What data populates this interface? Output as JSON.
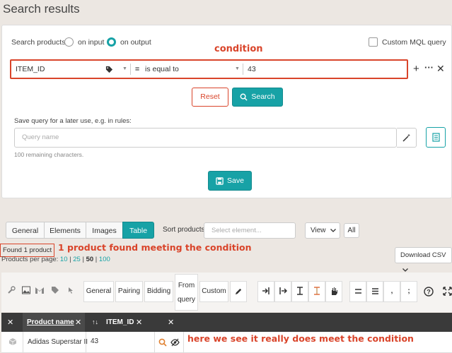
{
  "page": {
    "title": "Search results"
  },
  "search": {
    "label": "Search products:",
    "radio_input": "on input",
    "radio_output": "on output",
    "custom_mql": "Custom MQL query",
    "annotation": "condition",
    "field": "ITEM_ID",
    "operator": "is equal to",
    "value": "43",
    "reset": "Reset",
    "search": "Search"
  },
  "save_query": {
    "label": "Save query for a later use, e.g. in rules:",
    "placeholder": "Query name",
    "remaining": "100 remaining characters.",
    "save": "Save"
  },
  "tabs": [
    "General",
    "Elements",
    "Images",
    "Table"
  ],
  "sort": {
    "label": "Sort products",
    "placeholder": "Select element..."
  },
  "view": {
    "label": "View",
    "all": "All"
  },
  "found": {
    "text": "Found 1 product",
    "annotation": "1 product found meeting the condition"
  },
  "per_page": {
    "label": "Products per page:",
    "options": [
      "10",
      "25",
      "50",
      "100"
    ],
    "selected": "50"
  },
  "download": "Download CSV",
  "toolbar": {
    "general": "General",
    "pairing": "Pairing",
    "bidding": "Bidding",
    "from": "From",
    "query": "query",
    "custom": "Custom"
  },
  "table": {
    "col1": "Product name",
    "col2": "ITEM_ID",
    "row": {
      "name": "Adidas Superstar II",
      "id": "43"
    },
    "annotation": "here we see it really does meet the condition"
  },
  "colors": {
    "accent": "#17a2a6",
    "annotation": "#d9442a",
    "header": "#3a3a3a"
  }
}
